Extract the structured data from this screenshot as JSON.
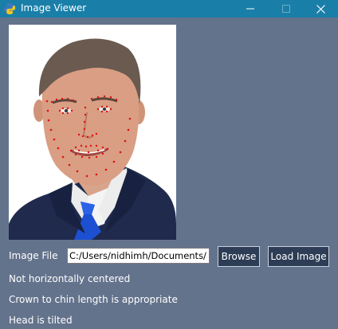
{
  "window": {
    "title": "Image Viewer",
    "icon": "python-icon",
    "controls": [
      "minimize-icon",
      "maximize-icon",
      "close-icon"
    ],
    "titlebar_color": "#1a7fa8",
    "background_color": "#64738c"
  },
  "form": {
    "image_file_label": "Image File",
    "image_file_value": "C:/Users/nidhimh/Documents/",
    "browse_label": "Browse",
    "load_label": "Load Image",
    "button_color": "#2d3d56"
  },
  "results": {
    "line1": "Not horizontally centered",
    "line2": "Crown to chin length is appropriate",
    "line3": "Head is tilted"
  },
  "photo": {
    "subject": "portrait of man in suit with facial landmark points",
    "landmark_color": "#e01010"
  }
}
